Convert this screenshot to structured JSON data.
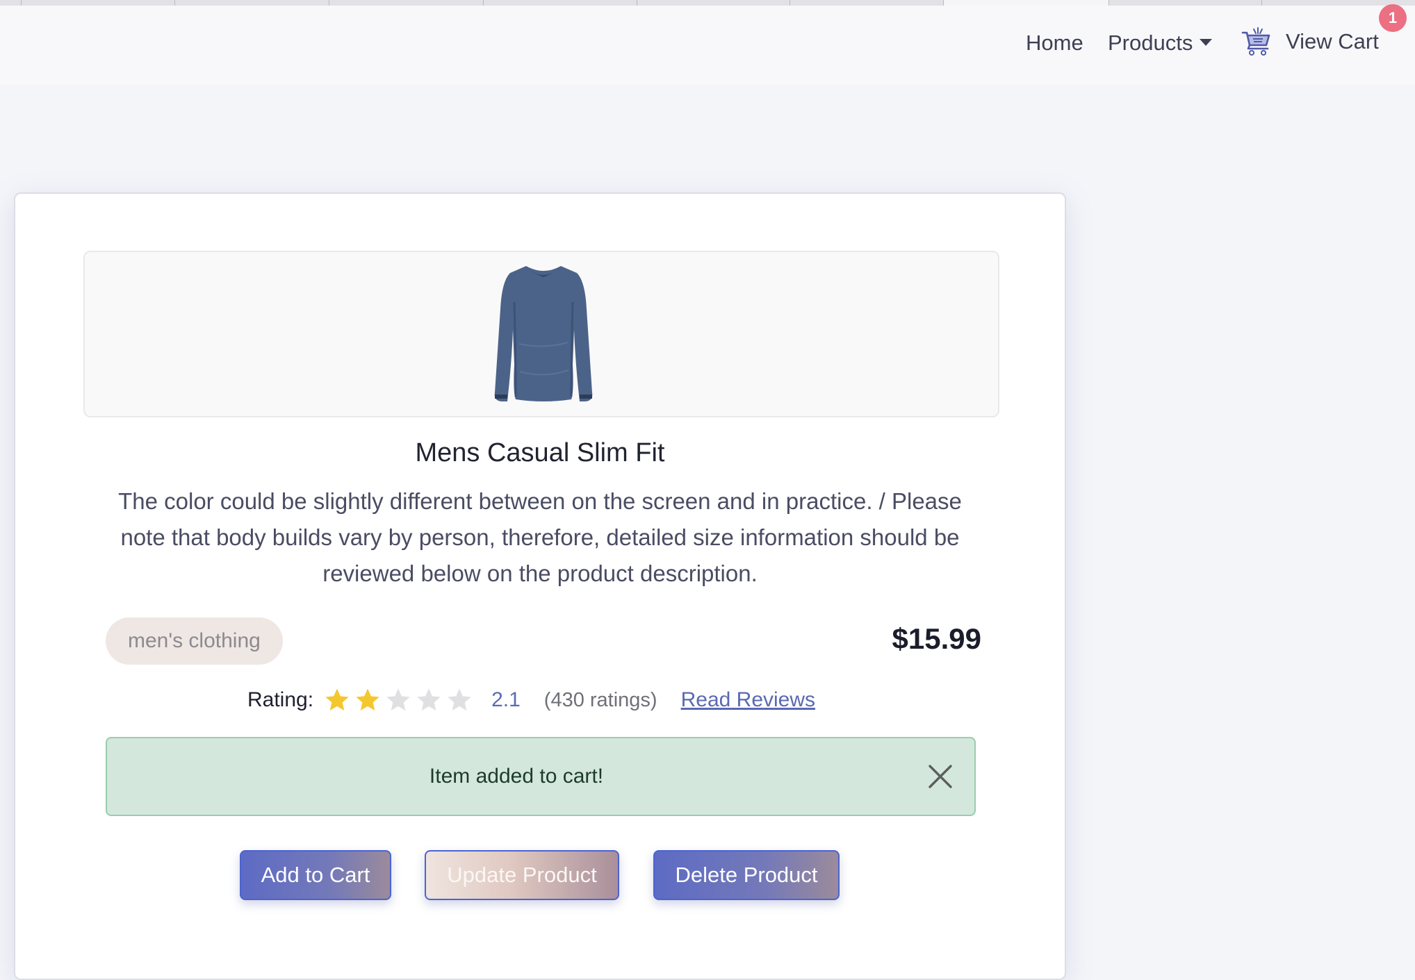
{
  "navbar": {
    "home_label": "Home",
    "products_label": "Products",
    "cart_label": "View Cart",
    "cart_count": "1",
    "cart_icon": "shopping-cart-icon"
  },
  "product": {
    "image_icon": "long-sleeve-shirt-image",
    "title": "Mens Casual Slim Fit",
    "description": "The color could be slightly different between on the screen and in practice. / Please note that body builds vary by person, therefore, detailed size information should be reviewed below on the product description.",
    "category": "men's clothing",
    "price": "$15.99"
  },
  "rating": {
    "label": "Rating:",
    "value": "2.1",
    "stars_filled": 2,
    "stars_total": 5,
    "count_text": "(430 ratings)",
    "read_reviews_label": "Read Reviews"
  },
  "alert": {
    "message": "Item added to cart!",
    "close_icon": "close-icon"
  },
  "actions": {
    "add_to_cart_label": "Add to Cart",
    "update_label": "Update Product",
    "delete_label": "Delete Product"
  },
  "colors": {
    "accent": "#5d6bc4",
    "badge": "#ec6f82",
    "alert_bg": "#d4e7dd",
    "star_filled": "#f5c72f",
    "star_empty": "#e0e0e3"
  }
}
